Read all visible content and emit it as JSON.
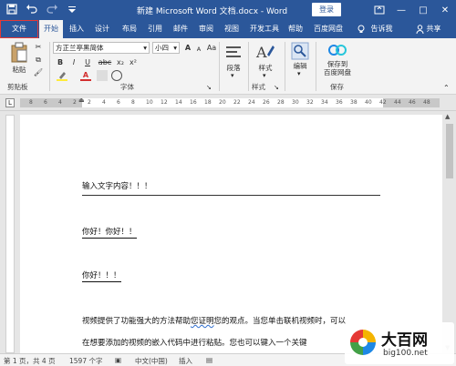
{
  "titlebar": {
    "title": "新建 Microsoft Word 文档.docx  -  Word",
    "login": "登录",
    "minimize": "—",
    "maximize": "□",
    "close": "✕"
  },
  "tabs": {
    "file": "文件",
    "home": "开始",
    "insert": "插入",
    "design": "设计",
    "layout": "布局",
    "references": "引用",
    "mailings": "邮件",
    "review": "审阅",
    "view": "视图",
    "developer": "开发工具",
    "help": "帮助",
    "baidu": "百度网盘",
    "tellme": "告诉我",
    "share": "共享"
  },
  "ribbon": {
    "paste": "粘贴",
    "clipboard": "剪贴板",
    "font_name": "方正兰亭黑简体",
    "font_size": "小四",
    "font_group": "字体",
    "paragraph": "段落",
    "styles": "样式",
    "styles_group": "样式",
    "editing": "编辑",
    "save_baidu_line1": "保存到",
    "save_baidu_line2": "百度网盘",
    "save_group": "保存",
    "bold": "B",
    "italic": "I",
    "underline": "U",
    "strike": "abc",
    "subscript": "x₂",
    "superscript": "x²",
    "case": "Aa",
    "grow": "A",
    "shrink": "A",
    "font_color": "A"
  },
  "ruler": {
    "ticks": [
      "8",
      "6",
      "4",
      "2",
      "2",
      "4",
      "6",
      "8",
      "10",
      "12",
      "14",
      "16",
      "18",
      "20",
      "22",
      "24",
      "26",
      "28",
      "30",
      "32",
      "34",
      "36",
      "38",
      "40",
      "42",
      "44",
      "46",
      "48"
    ]
  },
  "document": {
    "line1": "输入文字内容！！！",
    "line2": "你好！你好！！",
    "line3": "你好！！！",
    "line4a": "视频提供了功能强大的方法帮助",
    "line4b": "您证明",
    "line4c": "您的观点。当您单击联机视频时，可以",
    "line5": "在想要添加的视频的嵌入代码中进行粘贴。您也可以键入一个关键"
  },
  "statusbar": {
    "page": "第 1 页，共 4 页",
    "words": "1597 个字",
    "lang": "中文(中国)",
    "mode": "插入"
  },
  "watermark": {
    "title": "大百网",
    "url": "big100.net"
  },
  "colors": {
    "accent": "#2b579a",
    "file_outline": "#e53935"
  }
}
